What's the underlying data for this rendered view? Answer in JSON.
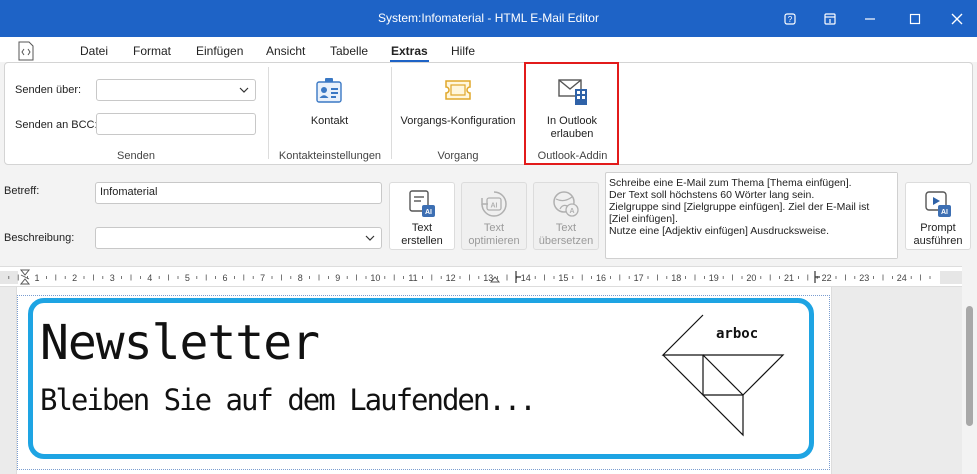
{
  "window": {
    "title": "System:Infomaterial - HTML E-Mail Editor"
  },
  "menu": {
    "items": [
      "Datei",
      "Format",
      "Einfügen",
      "Ansicht",
      "Tabelle",
      "Extras",
      "Hilfe"
    ],
    "active": "Extras"
  },
  "ribbon": {
    "senden": {
      "via_label": "Senden über:",
      "via_value": "",
      "bcc_label": "Senden an BCC:",
      "bcc_value": "",
      "group_label": "Senden"
    },
    "kontakt": {
      "button_label": "Kontakt",
      "group_label": "Kontakteinstellungen"
    },
    "vorgang": {
      "button_label": "Vorgangs-Konfiguration",
      "group_label": "Vorgang"
    },
    "outlook": {
      "button_label_line1": "In Outlook",
      "button_label_line2": "erlauben",
      "group_label": "Outlook-Addin"
    }
  },
  "message": {
    "betreff_label": "Betreff:",
    "betreff_value": "Infomaterial",
    "beschreibung_label": "Beschreibung:",
    "beschreibung_value": ""
  },
  "ai_buttons": {
    "create_line1": "Text",
    "create_line2": "erstellen",
    "optimize_line1": "Text",
    "optimize_line2": "optimieren",
    "translate_line1": "Text",
    "translate_line2": "übersetzen",
    "prompt_line1": "Prompt",
    "prompt_line2": "ausführen"
  },
  "prompt": {
    "lines": [
      "Schreibe eine E-Mail zum Thema [Thema einfügen].",
      "Der Text soll höchstens 60 Wörter lang sein.",
      "Zielgruppe sind [Zielgruppe einfügen]. Ziel der E-Mail ist",
      "[Ziel einfügen].",
      "Nutze eine [Adjektiv einfügen] Ausdrucksweise."
    ]
  },
  "ruler": {
    "numbers": [
      "1",
      "2",
      "3",
      "4",
      "5",
      "6",
      "7",
      "8",
      "9",
      "10",
      "11",
      "12",
      "13",
      "14",
      "15",
      "16",
      "17",
      "18",
      "19",
      "20",
      "21",
      "22",
      "23",
      "24"
    ]
  },
  "document": {
    "headline": "Newsletter",
    "subheadline": "Bleiben Sie auf dem Laufenden...",
    "logo_text": "arboc"
  },
  "colors": {
    "titlebar": "#1e63c6",
    "accent": "#1e63c6",
    "newsbox_border": "#1ea4e3",
    "highlight": "#e21b1b"
  }
}
